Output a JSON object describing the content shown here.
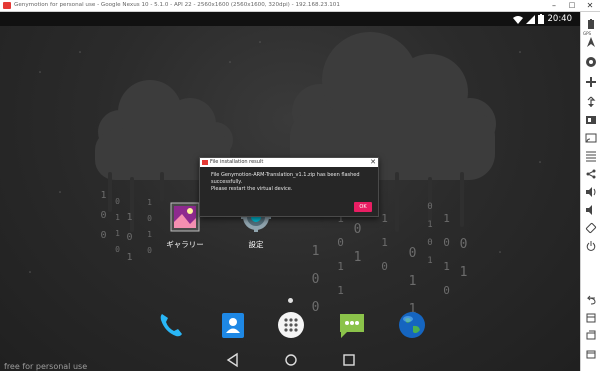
{
  "window": {
    "title": "Genymotion for personal use - Google Nexus 10 - 5.1.0 - API 22 - 2560x1600 (2560x1600, 320dpi) - 192.168.23.101",
    "minimize": "–",
    "maximize": "□",
    "close": "✕"
  },
  "statusbar": {
    "time": "20:40"
  },
  "dialog": {
    "title": "File installation result",
    "message_line1": "File Genymotion-ARM-Translation_v1.1.zip has been flashed successfully.",
    "message_line2": "Please restart the virtual device.",
    "ok_label": "OK",
    "close_label": "✕"
  },
  "apps": [
    {
      "label": "ギャラリー",
      "icon": "gallery-icon"
    },
    {
      "label": "設定",
      "icon": "settings-icon"
    }
  ],
  "dock": [
    {
      "icon": "phone-icon"
    },
    {
      "icon": "contacts-icon"
    },
    {
      "icon": "app-drawer-icon"
    },
    {
      "icon": "messaging-icon"
    },
    {
      "icon": "browser-icon"
    }
  ],
  "navbar": [
    "back-icon",
    "home-icon",
    "recents-icon"
  ],
  "watermark": "free for personal use",
  "sidebar": {
    "gps_label": "GPS",
    "items": [
      "battery-icon",
      "gps-icon",
      "camera-icon",
      "dpad-icon",
      "remote-control-icon",
      "id-icon",
      "screencast-icon",
      "share-icon",
      "volume-up-icon",
      "volume-down-icon",
      "rotate-icon",
      "power-icon",
      "back-icon",
      "menu-icon",
      "recents-icon",
      "home-icon"
    ]
  },
  "colors": {
    "accent": "#e91e63",
    "genymotion_red": "#e53935"
  }
}
